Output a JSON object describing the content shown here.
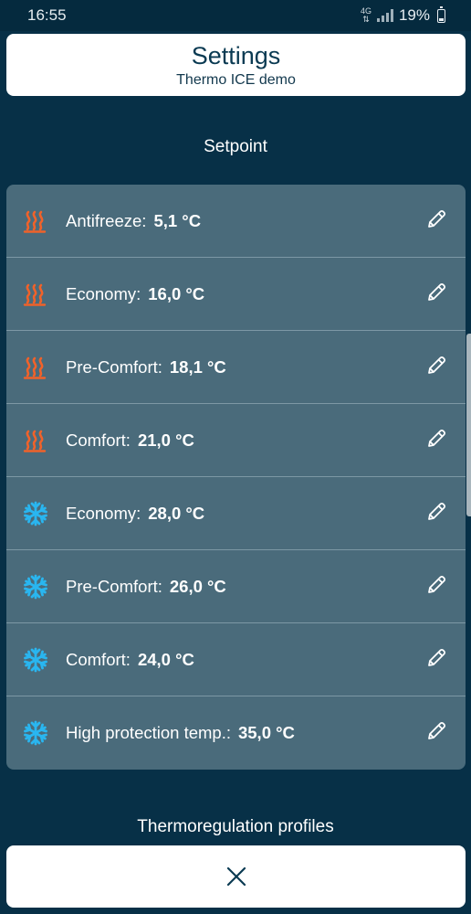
{
  "status_bar": {
    "time": "16:55",
    "network": "4G",
    "battery": "19%"
  },
  "header": {
    "title": "Settings",
    "subtitle": "Thermo ICE demo"
  },
  "setpoint_section": {
    "title": "Setpoint",
    "items": [
      {
        "mode": "heating",
        "icon": "heating-icon",
        "label": "Antifreeze:",
        "value": "5,1 °C"
      },
      {
        "mode": "heating",
        "icon": "heating-icon",
        "label": "Economy:",
        "value": "16,0 °C"
      },
      {
        "mode": "heating",
        "icon": "heating-icon",
        "label": "Pre-Comfort:",
        "value": "18,1 °C"
      },
      {
        "mode": "heating",
        "icon": "heating-icon",
        "label": "Comfort:",
        "value": "21,0 °C"
      },
      {
        "mode": "cooling",
        "icon": "snowflake-icon",
        "label": "Economy:",
        "value": "28,0 °C"
      },
      {
        "mode": "cooling",
        "icon": "snowflake-icon",
        "label": "Pre-Comfort:",
        "value": "26,0 °C"
      },
      {
        "mode": "cooling",
        "icon": "snowflake-icon",
        "label": "Comfort:",
        "value": "24,0 °C"
      },
      {
        "mode": "cooling",
        "icon": "snowflake-icon",
        "label": "High protection temp.:",
        "value": "35,0 °C"
      }
    ]
  },
  "profiles_section": {
    "title": "Thermoregulation profiles"
  },
  "colors": {
    "background": "#073047",
    "card": "#4a6b7b",
    "heating_icon": "#f0622a",
    "cooling_icon": "#29b6f0"
  }
}
